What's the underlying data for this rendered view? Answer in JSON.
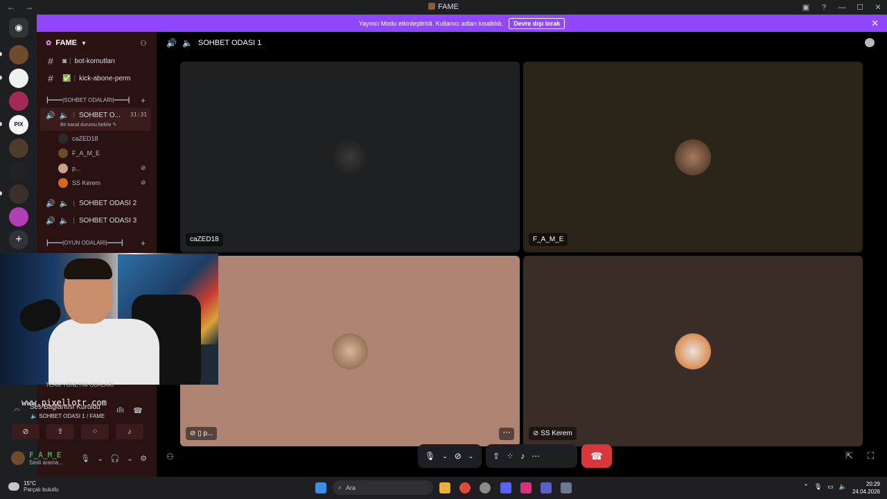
{
  "window": {
    "title": "FAME",
    "back": "←",
    "forward": "→",
    "controls": [
      "▣",
      "?",
      "—",
      "☐",
      "✕"
    ]
  },
  "banner": {
    "text": "Yayıncı Modu etkinleştirildi. Kullanıcı adları kısaltıldı.",
    "button": "Devre dışı bırak",
    "close": "✕"
  },
  "server": {
    "name": "FAME"
  },
  "channels": {
    "text": [
      {
        "name": "bot-komutları"
      },
      {
        "name": "kick-abone-perm"
      }
    ],
    "category1": "┣━━━━|SOHBET ODALARI|━━━━┫",
    "category2": "┣━━━━|OYUN ODALARI|━━━━┫",
    "category3": "TEAM YÖNETİM ODALARI",
    "active_voice": {
      "name": "SOHBET O...",
      "time": "31:31",
      "status": "Bir kanal durumu belirle"
    },
    "voice_users": [
      "caZED18",
      "F_A_M_E",
      "p...",
      "SS Kerem"
    ],
    "voice": [
      "SOHBET ODASI 2",
      "SOHBET ODASI 3"
    ]
  },
  "header": {
    "channel": "SOHBET ODASI 1"
  },
  "tiles": [
    {
      "name": "caZED18",
      "bg": "#1f2022"
    },
    {
      "name": "F_A_M_E",
      "bg": "#2b2419"
    },
    {
      "name": "p...",
      "bg": "#b08472"
    },
    {
      "name": "SS Kerem",
      "bg": "#3a2c26"
    }
  ],
  "watermark": "www.pixellotr.com",
  "voice_panel": {
    "title": "Ses Bağlantısı Kuruldu",
    "subtitle": "SOHBET ODASI 1 / FAME"
  },
  "user": {
    "name": "F_A_M_E",
    "status": "Sesli arama..."
  },
  "taskbar": {
    "temp": "15°C",
    "weather": "Parçalı bulutlu",
    "search": "Ara",
    "time": "20:29",
    "date": "24.04.2026"
  },
  "colors": {
    "banner": "#9147ff",
    "hangup": "#da373c",
    "sidebar": "#2b1212"
  }
}
